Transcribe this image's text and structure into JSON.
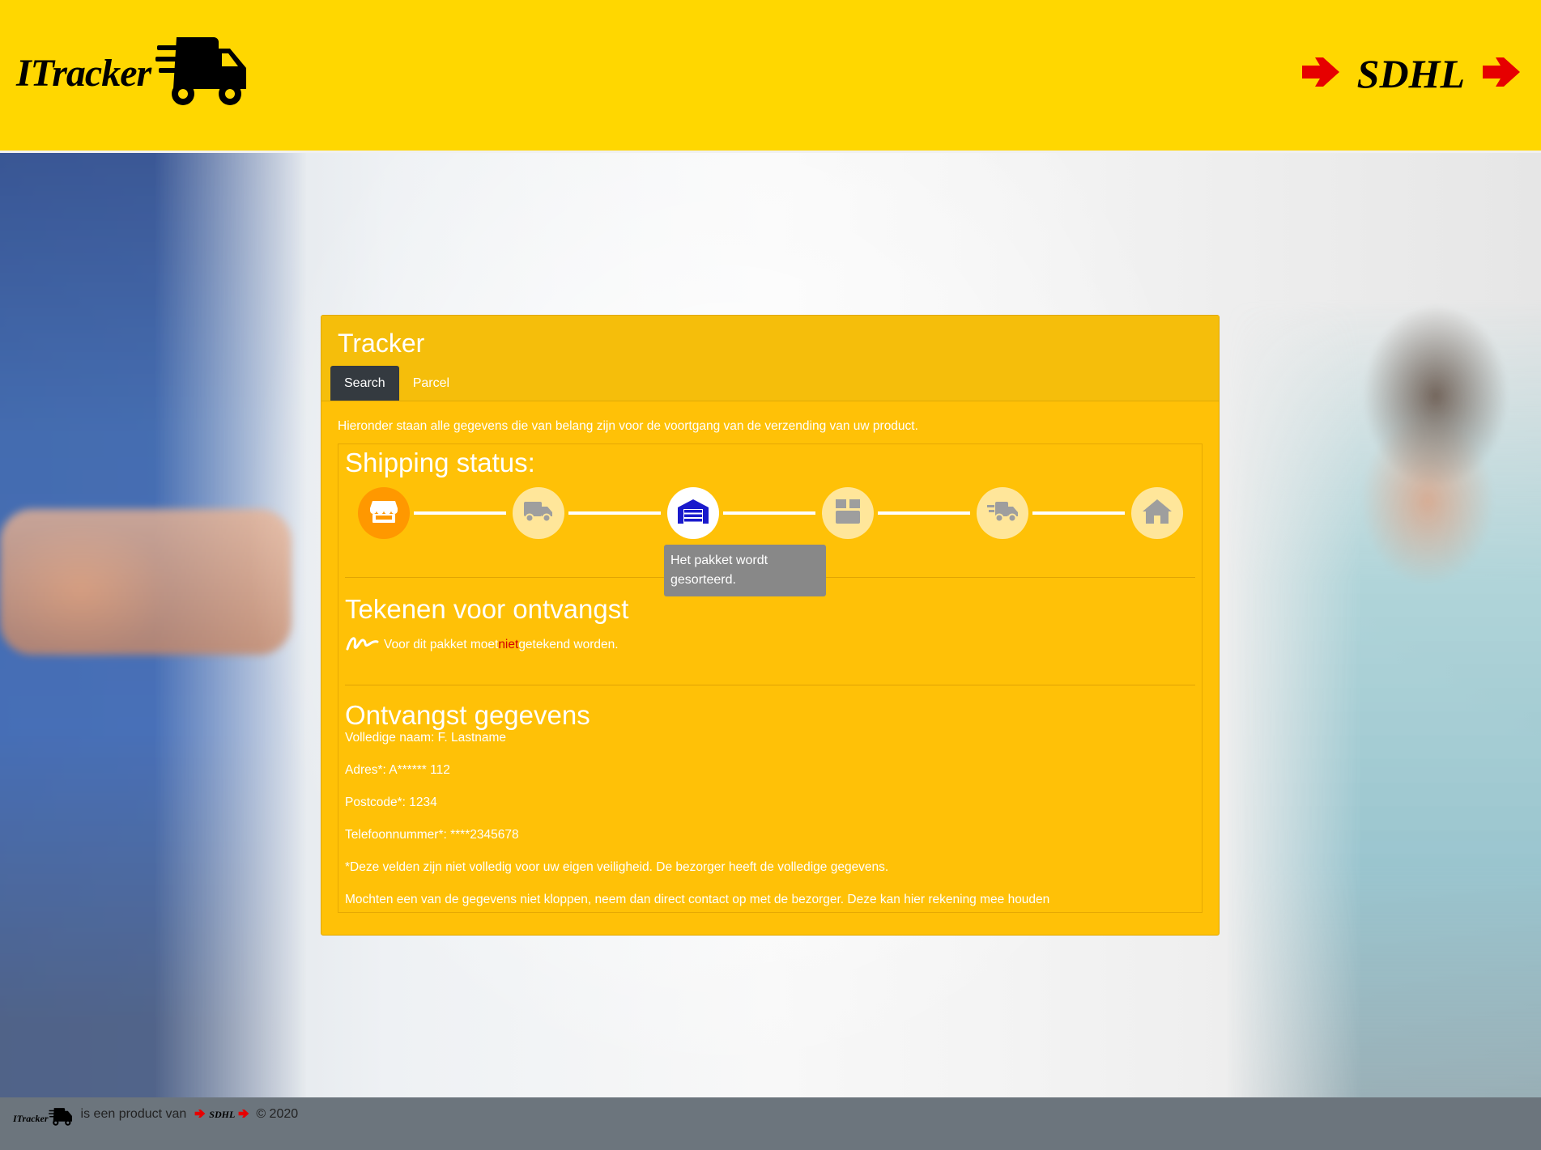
{
  "header": {
    "logo_text": "ITracker",
    "brand_text": "SDHL",
    "colors": {
      "background": "#ffd700",
      "arrow": "#e60000"
    }
  },
  "card": {
    "title": "Tracker",
    "tabs": [
      {
        "label": "Search",
        "active": true
      },
      {
        "label": "Parcel",
        "active": false
      }
    ],
    "intro": "Hieronder staan alle gegevens die van belang zijn voor de voortgang van de verzending van uw product.",
    "shipping": {
      "heading": "Shipping status:",
      "steps": [
        {
          "icon": "store-icon",
          "state": "done"
        },
        {
          "icon": "truck-icon",
          "state": "pending"
        },
        {
          "icon": "warehouse-icon",
          "state": "current"
        },
        {
          "icon": "package-icon",
          "state": "pending"
        },
        {
          "icon": "delivery-truck-icon",
          "state": "pending"
        },
        {
          "icon": "home-icon",
          "state": "pending"
        }
      ],
      "tooltip": "Het pakket wordt gesorteerd."
    },
    "sign": {
      "heading": "Tekenen voor ontvangst",
      "text_before": "Voor dit pakket moet ",
      "text_highlight": "niet",
      "text_after": " getekend worden."
    },
    "receipt": {
      "heading": "Ontvangst gegevens",
      "fields": [
        "Volledige naam: F. Lastname",
        "Adres*: A****** 112",
        "Postcode*: 1234",
        "Telefoonnummer*: ****2345678",
        "*Deze velden zijn niet volledig voor uw eigen veiligheid. De bezorger heeft de volledige gegevens.",
        "Mochten een van de gegevens niet kloppen, neem dan direct contact op met de bezorger. Deze kan hier rekening mee houden"
      ]
    }
  },
  "footer": {
    "logo_text": "ITracker",
    "middle_text": "is een product van",
    "brand_text": "SDHL",
    "copyright": "© 2020"
  }
}
